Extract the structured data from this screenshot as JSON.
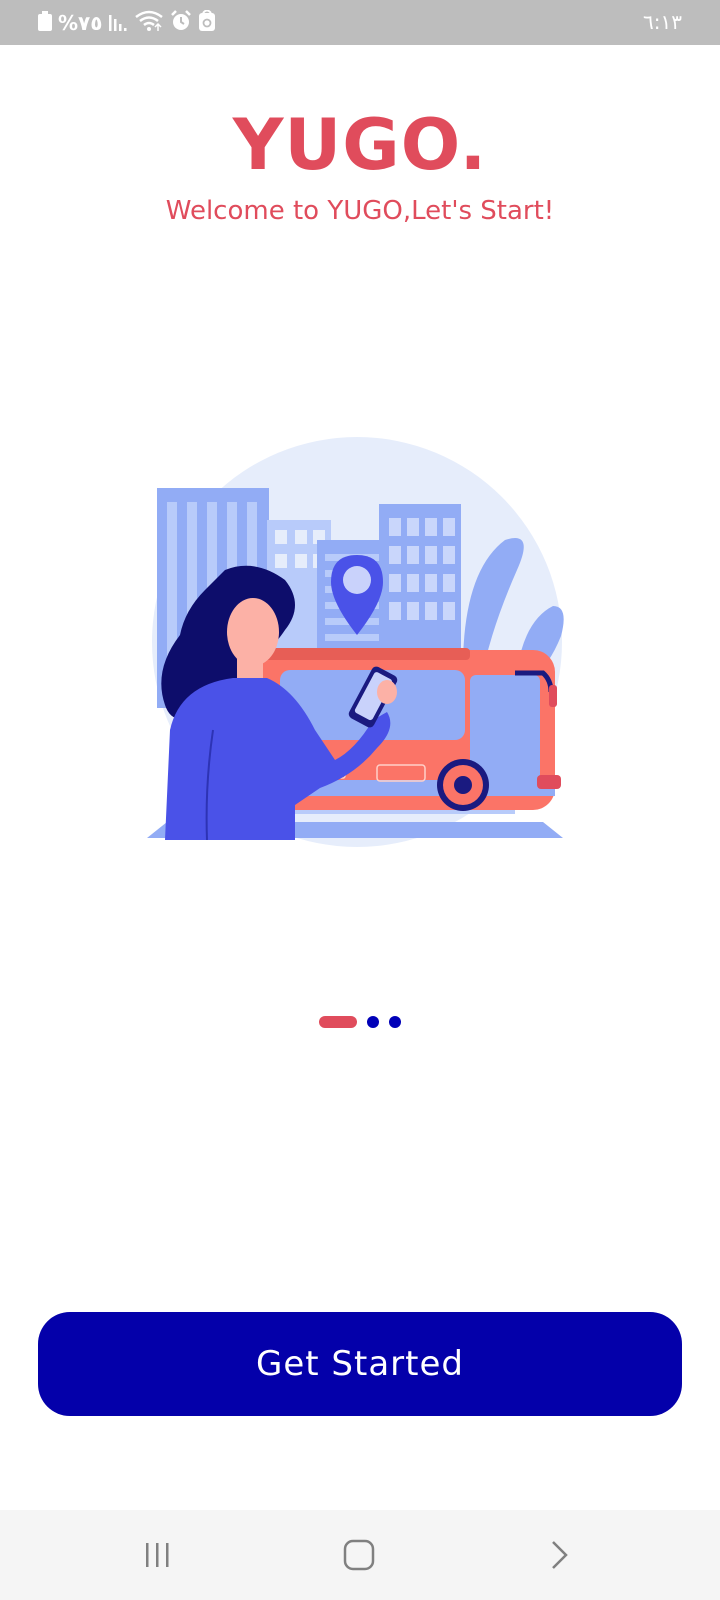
{
  "status_bar": {
    "battery_percent": "%٧٥",
    "time": "٦:١٣",
    "icons": [
      "battery-icon",
      "signal-icon",
      "wifi-icon",
      "alarm-icon",
      "app-notification-icon"
    ]
  },
  "header": {
    "title": "YUGO.",
    "subtitle": "Welcome to YUGO,Let's Start!"
  },
  "pager": {
    "page_count": 3,
    "active_index": 0
  },
  "cta": {
    "label": "Get Started"
  },
  "nav_bar": {
    "buttons": [
      "recent-apps-icon",
      "home-icon",
      "back-icon"
    ]
  },
  "colors": {
    "accent": "#e04c5c",
    "primary": "#0400aa",
    "status_bar": "#bdbdbd"
  }
}
